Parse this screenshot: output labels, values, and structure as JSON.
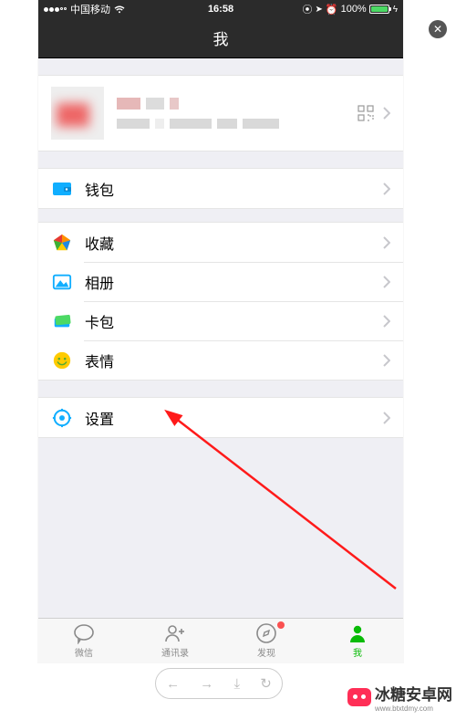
{
  "status": {
    "carrier": "中国移动",
    "time": "16:58",
    "battery_pct": "100%"
  },
  "nav": {
    "title": "我"
  },
  "profile": {
    "qr_label": "qr-code"
  },
  "menu": {
    "wallet": "钱包",
    "favorites": "收藏",
    "album": "相册",
    "cards": "卡包",
    "stickers": "表情",
    "settings": "设置"
  },
  "tabs": {
    "chats": "微信",
    "contacts": "通讯录",
    "discover": "发现",
    "me": "我"
  },
  "watermark": {
    "text": "冰糖安卓网",
    "domain": "www.btxtdmy.com"
  }
}
